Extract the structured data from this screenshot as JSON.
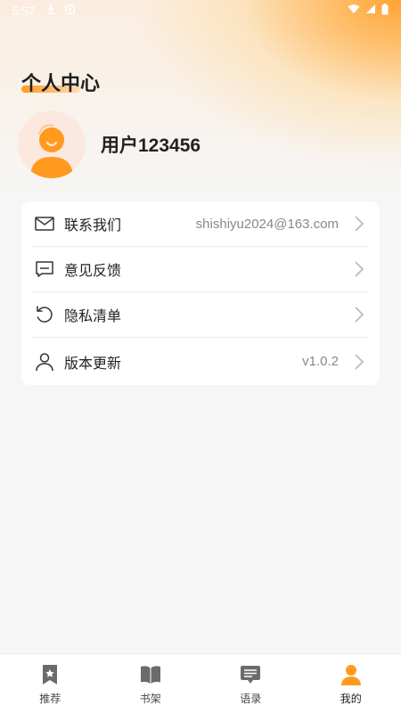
{
  "status_bar": {
    "time": "5:57",
    "icons": [
      "download-icon",
      "notification-icon",
      "wifi-icon",
      "signal-icon",
      "battery-icon"
    ]
  },
  "header": {
    "title": "个人中心"
  },
  "profile": {
    "username": "用户123456",
    "avatar_icon": "user-avatar-icon",
    "avatar_color": "#ff9a1f"
  },
  "menu": {
    "items": [
      {
        "label": "联系我们",
        "value": "shishiyu2024@163.com",
        "icon": "mail-icon"
      },
      {
        "label": "意见反馈",
        "value": "",
        "icon": "feedback-icon"
      },
      {
        "label": "隐私清单",
        "value": "",
        "icon": "refresh-icon"
      },
      {
        "label": "版本更新",
        "value": "v1.0.2",
        "icon": "person-icon"
      }
    ]
  },
  "tabbar": {
    "tabs": [
      {
        "label": "推荐",
        "icon": "bookmark-star-icon",
        "active": false
      },
      {
        "label": "书架",
        "icon": "book-icon",
        "active": false
      },
      {
        "label": "语录",
        "icon": "quote-icon",
        "active": false
      },
      {
        "label": "我的",
        "icon": "profile-icon",
        "active": true
      }
    ],
    "active_color": "#ff9a1f",
    "inactive_color": "#6b6b6b"
  }
}
